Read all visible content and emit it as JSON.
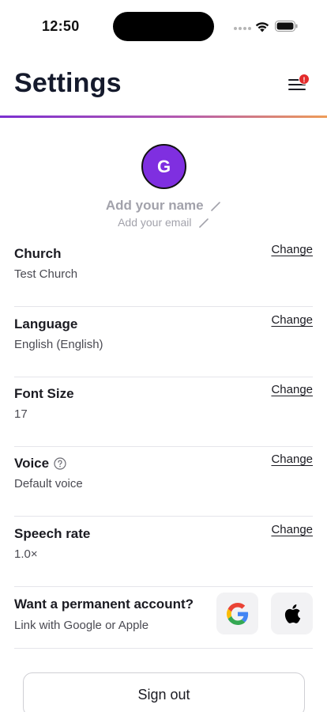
{
  "status_bar": {
    "time": "12:50"
  },
  "header": {
    "title": "Settings",
    "menu_badge": "!"
  },
  "profile": {
    "avatar_initial": "G",
    "name_placeholder": "Add your name",
    "email_placeholder": "Add your email",
    "avatar_color": "#7f2fe0"
  },
  "settings": [
    {
      "title": "Church",
      "value": "Test Church",
      "action": "Change"
    },
    {
      "title": "Language",
      "value": "English (English)",
      "action": "Change"
    },
    {
      "title": "Font Size",
      "value": "17",
      "action": "Change"
    },
    {
      "title": "Voice",
      "value": "Default voice",
      "action": "Change"
    },
    {
      "title": "Speech rate",
      "value": "1.0×",
      "action": "Change"
    }
  ],
  "account": {
    "title": "Want a permanent account?",
    "subtitle": "Link with Google or Apple"
  },
  "sign_out_label": "Sign out",
  "colors": {
    "accent_gradient": [
      "#7b2fd0",
      "#ee9c58"
    ],
    "badge": "#e32b2b"
  }
}
